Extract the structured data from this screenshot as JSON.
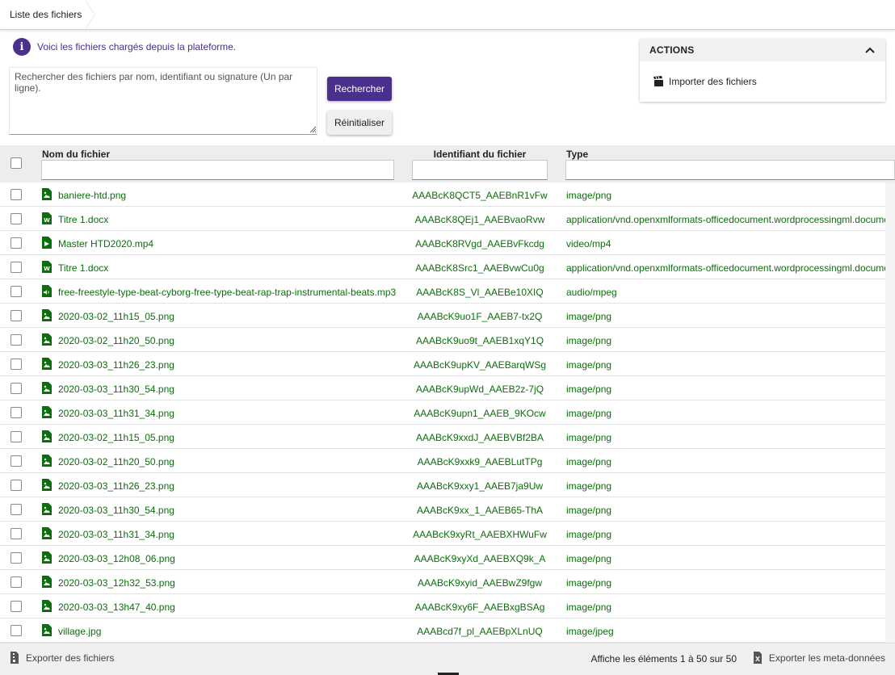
{
  "breadcrumb": {
    "title": "Liste des fichiers"
  },
  "info": {
    "message": "Voici les fichiers chargés depuis la plateforme."
  },
  "search": {
    "placeholder": "Rechercher des fichiers par nom, identifiant ou signature (Un par ligne).",
    "value": "",
    "search_button": "Rechercher",
    "reset_button": "Réinitialiser"
  },
  "actions": {
    "title": "ACTIONS",
    "items": [
      {
        "label": "Importer des fichiers",
        "icon": "clapperboard-icon"
      }
    ]
  },
  "table": {
    "columns": [
      "Nom du fichier",
      "Identifiant du fichier",
      "Type"
    ],
    "rows": [
      {
        "name": "baniere-htd.png",
        "id": "AAABcK8QCT5_AAEBnR1vFw",
        "type": "image/png",
        "icon": "image"
      },
      {
        "name": "Titre 1.docx",
        "id": "AAABcK8QEj1_AAEBvaoRvw",
        "type": "application/vnd.openxmlformats-officedocument.wordprocessingml.document",
        "icon": "word"
      },
      {
        "name": "Master HTD2020.mp4",
        "id": "AAABcK8RVgd_AAEBvFkcdg",
        "type": "video/mp4",
        "icon": "video"
      },
      {
        "name": "Titre 1.docx",
        "id": "AAABcK8Src1_AAEBvwCu0g",
        "type": "application/vnd.openxmlformats-officedocument.wordprocessingml.document",
        "icon": "word"
      },
      {
        "name": "free-freestyle-type-beat-cyborg-free-type-beat-rap-trap-instrumental-beats.mp3",
        "id": "AAABcK8S_Vl_AAEBe10XIQ",
        "type": "audio/mpeg",
        "icon": "audio"
      },
      {
        "name": "2020-03-02_11h15_05.png",
        "id": "AAABcK9uo1F_AAEB7-tx2Q",
        "type": "image/png",
        "icon": "image"
      },
      {
        "name": "2020-03-02_11h20_50.png",
        "id": "AAABcK9uo9t_AAEB1xqY1Q",
        "type": "image/png",
        "icon": "image"
      },
      {
        "name": "2020-03-03_11h26_23.png",
        "id": "AAABcK9upKV_AAEBarqWSg",
        "type": "image/png",
        "icon": "image"
      },
      {
        "name": "2020-03-03_11h30_54.png",
        "id": "AAABcK9upWd_AAEB2z-7jQ",
        "type": "image/png",
        "icon": "image"
      },
      {
        "name": "2020-03-03_11h31_34.png",
        "id": "AAABcK9upn1_AAEB_9KOcw",
        "type": "image/png",
        "icon": "image"
      },
      {
        "name": "2020-03-02_11h15_05.png",
        "id": "AAABcK9xxdJ_AAEBVBf2BA",
        "type": "image/png",
        "icon": "image"
      },
      {
        "name": "2020-03-02_11h20_50.png",
        "id": "AAABcK9xxk9_AAEBLutTPg",
        "type": "image/png",
        "icon": "image"
      },
      {
        "name": "2020-03-03_11h26_23.png",
        "id": "AAABcK9xxy1_AAEB7ja9Uw",
        "type": "image/png",
        "icon": "image"
      },
      {
        "name": "2020-03-03_11h30_54.png",
        "id": "AAABcK9xx_1_AAEB65-ThA",
        "type": "image/png",
        "icon": "image"
      },
      {
        "name": "2020-03-03_11h31_34.png",
        "id": "AAABcK9xyRt_AAEBXHWuFw",
        "type": "image/png",
        "icon": "image"
      },
      {
        "name": "2020-03-03_12h08_06.png",
        "id": "AAABcK9xyXd_AAEBXQ9k_A",
        "type": "image/png",
        "icon": "image"
      },
      {
        "name": "2020-03-03_12h32_53.png",
        "id": "AAABcK9xyid_AAEBwZ9fgw",
        "type": "image/png",
        "icon": "image"
      },
      {
        "name": "2020-03-03_13h47_40.png",
        "id": "AAABcK9xy6F_AAEBxgBSAg",
        "type": "image/png",
        "icon": "image"
      },
      {
        "name": "village.jpg",
        "id": "AAABcd7f_pl_AAEBpXLnUQ",
        "type": "image/jpeg",
        "icon": "image"
      }
    ]
  },
  "footer": {
    "export_files": "Exporter des fichiers",
    "count": "Affiche les éléments 1 à 50 sur 50",
    "export_metadata": "Exporter les meta-données"
  },
  "colors": {
    "accent": "#4a2f8c",
    "link": "#0d6e0d",
    "header_bg": "#ededed"
  }
}
